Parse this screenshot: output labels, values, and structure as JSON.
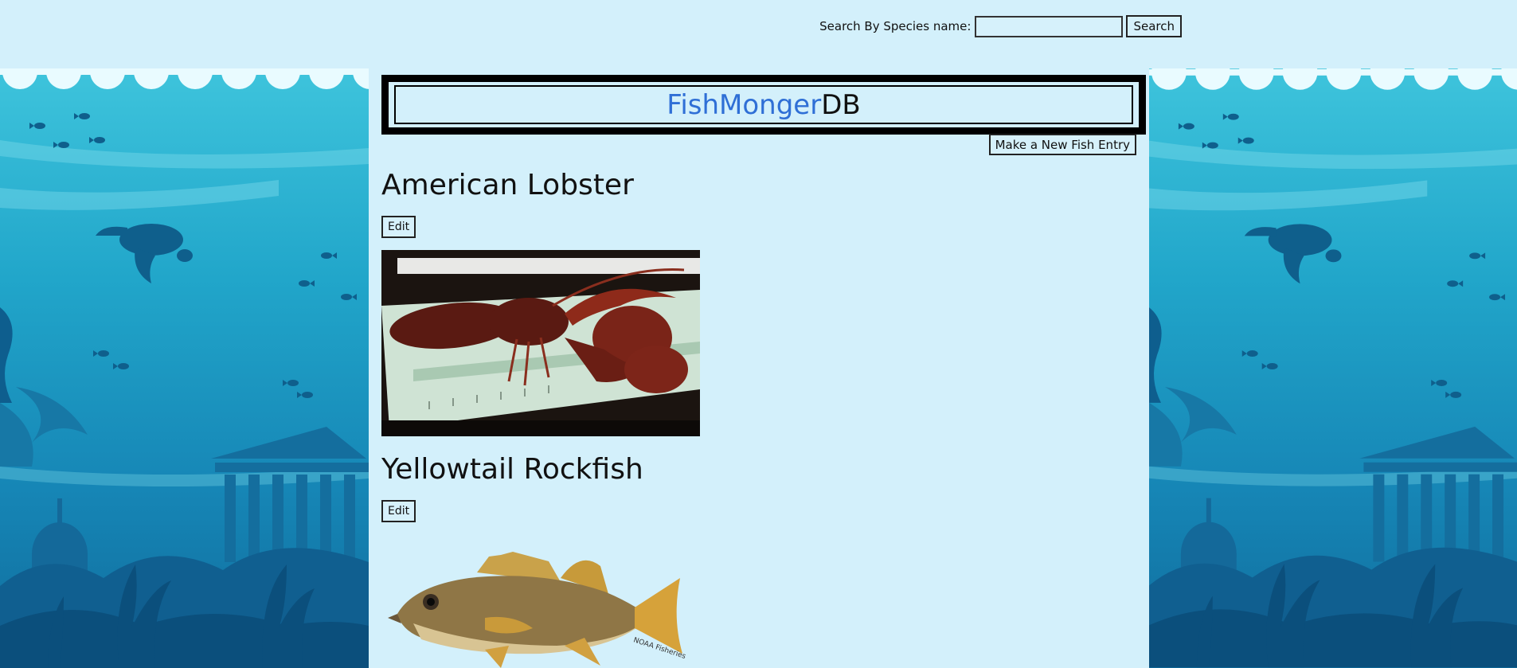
{
  "search": {
    "label": "Search By Species name:",
    "value": "",
    "placeholder": "",
    "button_label": "Search"
  },
  "header": {
    "brand_part1": "FishMonger",
    "brand_part2": "DB",
    "brand_color": "#2f6fd6"
  },
  "actions": {
    "new_entry_label": "Make a New Fish Entry"
  },
  "entries": [
    {
      "name": "American Lobster",
      "edit_label": "Edit",
      "image": "lobster-photo"
    },
    {
      "name": "Yellowtail Rockfish",
      "edit_label": "Edit",
      "image": "rockfish-photo",
      "image_caption": "NOAA Fisheries"
    }
  ],
  "colors": {
    "page_background": "#d3f0fb",
    "ocean_top": "#3ec4dc",
    "ocean_bottom": "#106c9c"
  }
}
